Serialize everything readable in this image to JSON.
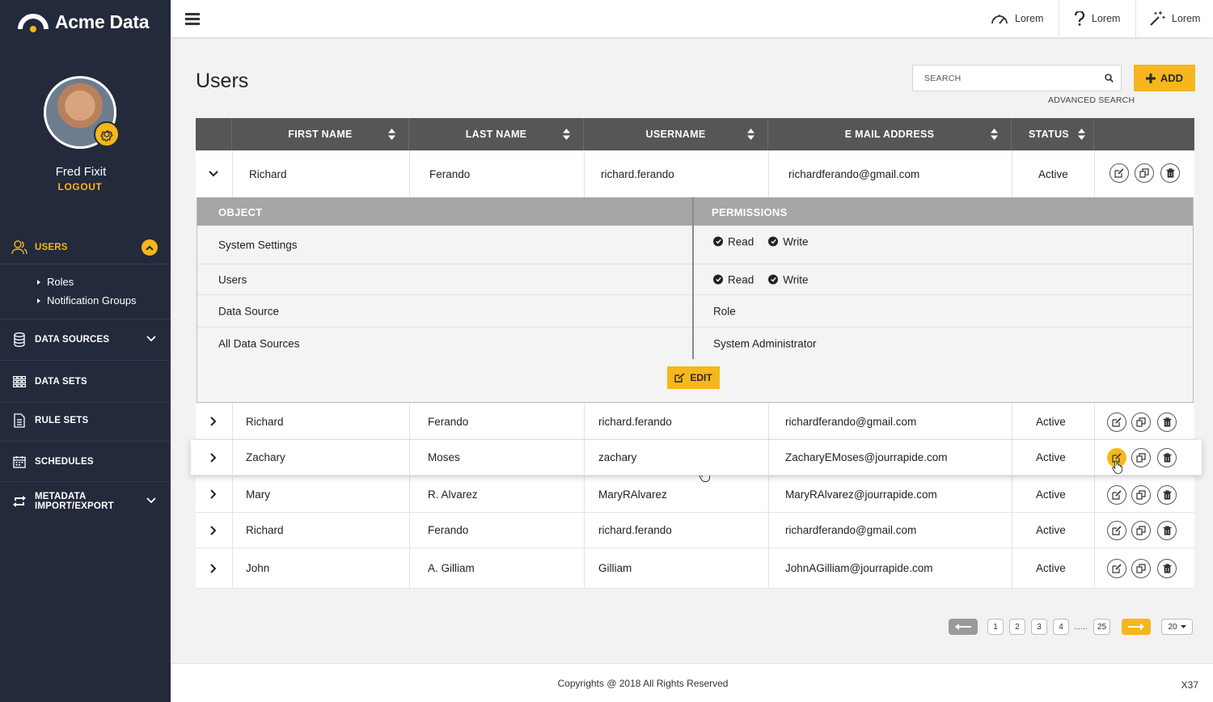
{
  "app": {
    "name": "Acme Data"
  },
  "user": {
    "name": "Fred Fixit",
    "logout": "LOGOUT"
  },
  "sidebar": {
    "items": [
      {
        "label": "USERS",
        "icon": "users-icon",
        "active": true
      },
      {
        "label": "DATA SOURCES",
        "icon": "database-icon"
      },
      {
        "label": "DATA SETS",
        "icon": "grid-icon"
      },
      {
        "label": "RULE SETS",
        "icon": "document-icon"
      },
      {
        "label": "SCHEDULES",
        "icon": "calendar-icon"
      },
      {
        "label_line1": "METADATA",
        "label_line2": "IMPORT/EXPORT",
        "icon": "sync-icon"
      }
    ],
    "sub_items": [
      "Roles",
      "Notification Groups"
    ]
  },
  "topbar": {
    "buttons": [
      {
        "label": "Lorem",
        "icon": "speedometer-icon"
      },
      {
        "label": "Lorem",
        "icon": "question-icon"
      },
      {
        "label": "Lorem",
        "icon": "magic-wand-icon"
      }
    ]
  },
  "main": {
    "title": "Users",
    "search": {
      "placeholder": "SEARCH",
      "advanced": "ADVANCED SEARCH"
    },
    "add_label": "ADD"
  },
  "table": {
    "columns": [
      "FIRST NAME",
      "LAST NAME",
      "USERNAME",
      "E MAIL ADDRESS",
      "STATUS"
    ],
    "expanded_row": {
      "first": "Richard",
      "last": "Ferando",
      "username": "richard.ferando",
      "email": "richardferando@gmail.com",
      "status": "Active"
    },
    "rows": [
      {
        "first": "Richard",
        "last": "Ferando",
        "username": "richard.ferando",
        "email": "richardferando@gmail.com",
        "status": "Active"
      },
      {
        "first": "Zachary",
        "last": "Moses",
        "username": "zachary",
        "email": "ZacharyEMoses@jourrapide.com",
        "status": "Active"
      },
      {
        "first": "Mary",
        "last": "R. Alvarez",
        "username": "MaryRAlvarez",
        "email": "MaryRAlvarez@jourrapide.com",
        "status": "Active"
      },
      {
        "first": "Richard",
        "last": "Ferando",
        "username": "richard.ferando",
        "email": "richardferando@gmail.com",
        "status": "Active"
      },
      {
        "first": "John",
        "last": "A. Gilliam",
        "username": "Gilliam",
        "email": "JohnAGilliam@jourrapide.com",
        "status": "Active"
      }
    ]
  },
  "permissions": {
    "head_object": "OBJECT",
    "head_permissions": "PERMISSIONS",
    "rows": [
      {
        "object": "System Settings",
        "read": "Read",
        "write": "Write"
      },
      {
        "object": "Users",
        "read": "Read",
        "write": "Write"
      },
      {
        "object": "Data Source",
        "value": "Role"
      },
      {
        "object": "All Data Sources",
        "value": "System Administrator"
      }
    ],
    "edit_label": "EDIT"
  },
  "pagination": {
    "pages": [
      "1",
      "2",
      "3",
      "4"
    ],
    "ellipsis": "......",
    "last": "25",
    "per_page": "20"
  },
  "footer": {
    "copyright": "Copyrights @ 2018 All Rights Reserved",
    "version": "X37"
  },
  "colors": {
    "accent": "#f5b71b",
    "sidebar": "#232a3b",
    "header": "#565656"
  }
}
